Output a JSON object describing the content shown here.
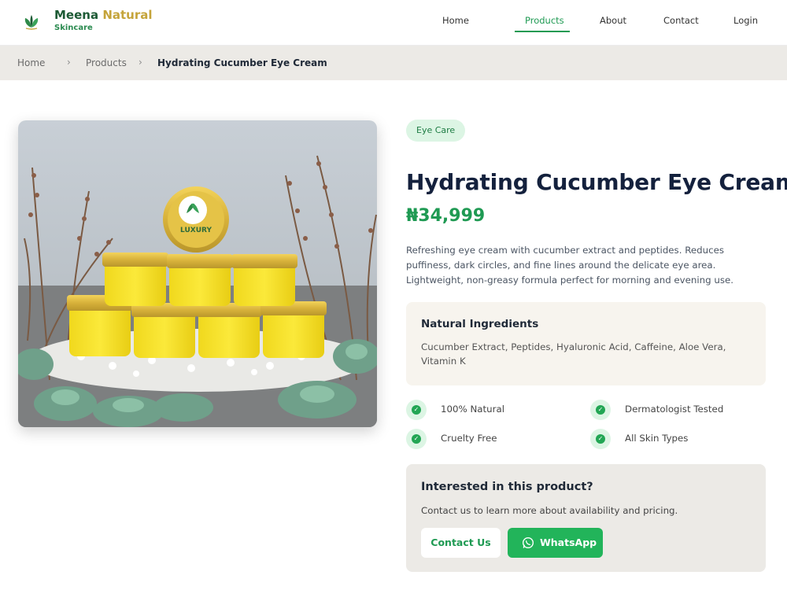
{
  "header": {
    "brand_name_1": "Meena",
    "brand_name_2": "Natural",
    "brand_sub": "Skincare",
    "logo_icon": "leaf-logo-icon",
    "nav": [
      {
        "label": "Home",
        "active": false
      },
      {
        "label": "Products",
        "active": true
      },
      {
        "label": "About",
        "active": false
      },
      {
        "label": "Contact",
        "active": false
      },
      {
        "label": "Login",
        "active": false
      }
    ]
  },
  "breadcrumb": {
    "items": [
      "Home",
      "Products",
      "Hydrating Cucumber Eye Cream"
    ],
    "separator": "›"
  },
  "product": {
    "category": "Eye Care",
    "title": "Hydrating Cucumber Eye Cream",
    "price": "₦34,999",
    "description": "Refreshing eye cream with cucumber extract and peptides. Reduces puffiness, dark circles, and fine lines around the delicate eye area. Lightweight, non-greasy formula perfect for morning and evening use.",
    "ingredients_title": "Natural Ingredients",
    "ingredients": "Cucumber Extract, Peptides, Hyaluronic Acid, Caffeine, Aloe Vera, Vitamin K",
    "features": [
      "100% Natural",
      "Dermatologist Tested",
      "Cruelty Free",
      "All Skin Types"
    ],
    "jar_label": "LUXURY"
  },
  "cta": {
    "title": "Interested in this product?",
    "text": "Contact us to learn more about availability and pricing.",
    "contact_label": "Contact Us",
    "whatsapp_label": "WhatsApp"
  },
  "colors": {
    "accent": "#1f9a53",
    "gold": "#c5a43a",
    "whatsapp": "#22b45a"
  }
}
